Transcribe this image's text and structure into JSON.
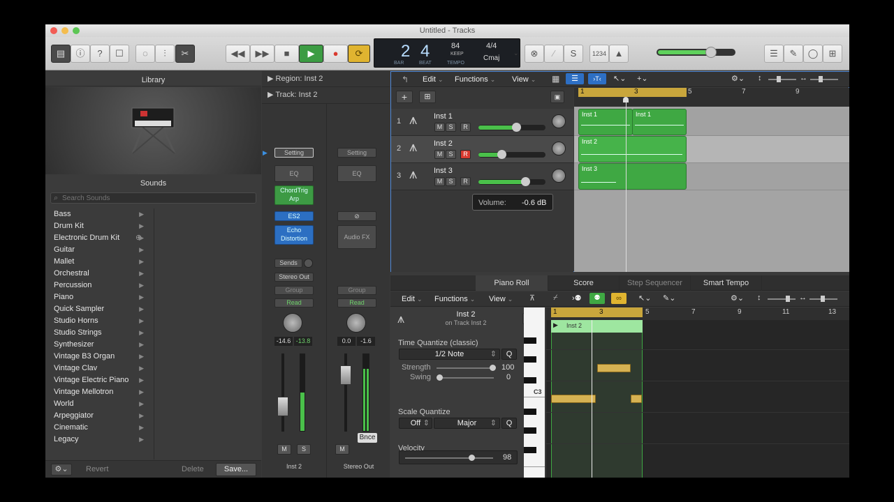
{
  "window": {
    "title": "Untitled - Tracks"
  },
  "lcd": {
    "bar": "2",
    "beat": "4",
    "bar_label": "BAR",
    "beat_label": "BEAT",
    "tempo": "84",
    "keep": "KEEP",
    "tempo_label": "TEMPO",
    "signature": "4/4",
    "key": "Cmaj",
    "cycle_hint": "1234"
  },
  "library": {
    "title": "Library",
    "sounds_title": "Sounds",
    "search_placeholder": "Search Sounds",
    "items": [
      {
        "label": "Bass"
      },
      {
        "label": "Drum Kit"
      },
      {
        "label": "Electronic Drum Kit"
      },
      {
        "label": "Guitar"
      },
      {
        "label": "Mallet"
      },
      {
        "label": "Orchestral"
      },
      {
        "label": "Percussion"
      },
      {
        "label": "Piano"
      },
      {
        "label": "Quick Sampler"
      },
      {
        "label": "Studio Horns"
      },
      {
        "label": "Studio Strings"
      },
      {
        "label": "Synthesizer"
      },
      {
        "label": "Vintage B3 Organ"
      },
      {
        "label": "Vintage Clav"
      },
      {
        "label": "Vintage Electric Piano"
      },
      {
        "label": "Vintage Mellotron"
      },
      {
        "label": "World"
      },
      {
        "label": "Arpeggiator"
      },
      {
        "label": "Cinematic"
      },
      {
        "label": "Legacy"
      }
    ],
    "footer": {
      "revert": "Revert",
      "delete": "Delete",
      "save": "Save..."
    }
  },
  "inspector": {
    "region_label": "Region:",
    "region_name": "Inst 2",
    "track_label": "Track:",
    "track_name": "Inst 2",
    "strip1": {
      "setting": "Setting",
      "eq": "EQ",
      "chord": "ChordTrig",
      "arp": "Arp",
      "instrument": "ES2",
      "fx1": "Echo",
      "fx2": "Distortion",
      "sends": "Sends",
      "output": "Stereo Out",
      "group": "Group",
      "automation": "Read",
      "val1": "-14.6",
      "val2": "-13.8",
      "m": "M",
      "s": "S",
      "name": "Inst 2"
    },
    "strip2": {
      "setting": "Setting",
      "eq": "EQ",
      "audiofx": "Audio FX",
      "group": "Group",
      "automation": "Read",
      "val1": "0.0",
      "val2": "-1.6",
      "m": "M",
      "bnce": "Bnce",
      "name": "Stereo Out"
    }
  },
  "tracks_menu": {
    "edit": "Edit",
    "functions": "Functions",
    "view": "View"
  },
  "ruler": {
    "marks": [
      "1",
      "3",
      "5",
      "7",
      "9"
    ]
  },
  "tracks": [
    {
      "num": "1",
      "name": "Inst 1",
      "m": "M",
      "s": "S",
      "r": "R",
      "volume": 0.58
    },
    {
      "num": "2",
      "name": "Inst 2",
      "m": "M",
      "s": "S",
      "r": "R",
      "volume": 0.32
    },
    {
      "num": "3",
      "name": "Inst 3",
      "m": "M",
      "s": "S",
      "r": "R",
      "volume": 0.74
    }
  ],
  "regions": {
    "r1a": "Inst 1",
    "r1b": "Inst 1",
    "r2": "Inst 2",
    "r3": "Inst 3"
  },
  "tooltip": {
    "label": "Volume:",
    "value": "-0.6 dB"
  },
  "editor": {
    "tabs": [
      "Piano Roll",
      "Score",
      "Step Sequencer",
      "Smart Tempo"
    ],
    "menu": {
      "edit": "Edit",
      "functions": "Functions",
      "view": "View"
    },
    "region_name": "Inst 2",
    "region_sub": "on Track Inst 2",
    "tq_title": "Time Quantize (classic)",
    "tq_value": "1/2 Note",
    "q": "Q",
    "strength_label": "Strength",
    "strength_value": "100",
    "swing_label": "Swing",
    "swing_value": "0",
    "sq_title": "Scale Quantize",
    "sq_off": "Off",
    "sq_scale": "Major",
    "sq_q": "Q",
    "vel_title": "Velocity",
    "vel_value": "98",
    "vel_level": 0.78,
    "c3": "C3",
    "ruler": [
      "1",
      "3",
      "5",
      "7",
      "9",
      "11",
      "13"
    ],
    "region_label": "Inst 2"
  },
  "colors": {
    "region_green": "#3fa843",
    "note_gold": "#d6b253",
    "accent_blue": "#2c6fc2",
    "record_red": "#d93a2f"
  }
}
